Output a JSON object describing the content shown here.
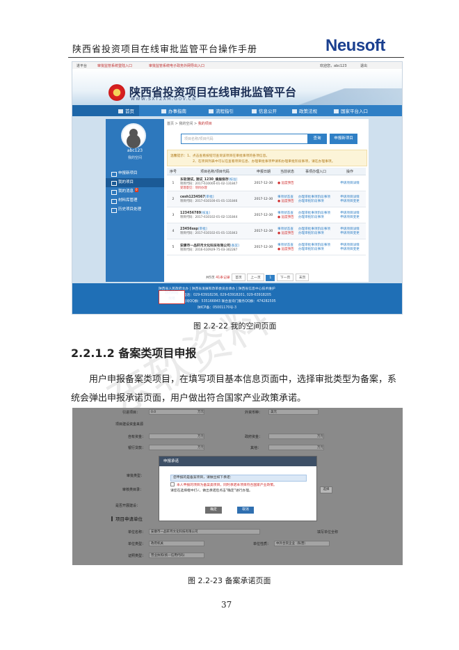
{
  "header": {
    "doc_title": "陕西省投资项目在线审批监管平台操作手册",
    "brand": "Neusoft"
  },
  "screenshot1": {
    "topbar": {
      "home": "进平台",
      "link1": "审批监管系统登陆入口",
      "link2": "审批监管系统电子政务外网导出入口",
      "welcome": "欢迎您，abc123",
      "logout": "退出"
    },
    "site_title": "陕西省投资项目在线审批监管平台",
    "site_url": "WWW.SXTZXM.GOV.CN",
    "nav": [
      "首页",
      "办事指南",
      "流程指引",
      "信息公开",
      "政策法规",
      "国家平台入口"
    ],
    "user": {
      "name": "abc123",
      "space": "我的空间"
    },
    "side_menu": [
      {
        "label": "申报新项目"
      },
      {
        "label": "我的项目"
      },
      {
        "label": "我的消息",
        "badge": "0"
      },
      {
        "label": "材料库管理"
      },
      {
        "label": "历史项目处理"
      }
    ],
    "breadcrumb": {
      "prefix": "首页 > 我的空间 > ",
      "current": "我的项目"
    },
    "search": {
      "placeholder": "项目名称/项目代码",
      "query_btn": "查询",
      "apply_btn": "申报新项目"
    },
    "notice": {
      "line1": "温馨提示：1、点击查看按钮可查询该项目在审批事项的各项信息。",
      "line2": "2、在项目列表中可以在查看项目信息、办理审批事项申请和办理审批阶段事项，请在办理事项。"
    },
    "table": {
      "headers": [
        "序号",
        "项目名称/项目代码",
        "申报日期",
        "当前状态",
        "事项办理入口",
        "操作"
      ],
      "rows": [
        {
          "no": "1",
          "name": "东软测试, 测试_1230_填报保存",
          "tag": "[核准]",
          "code": "项目代码：2017-610000-01-02-131847",
          "note": "受理意见：项目办理",
          "date": "2017-12-30",
          "status": "● 远度预告",
          "status2": "",
          "entry1": "",
          "entry2": "",
          "op1": "申请项目详情",
          "op2": ""
        },
        {
          "no": "2",
          "name": "cesh1234567",
          "tag": "[审批]",
          "code": "项目代码：2017-610100-01-01-131846",
          "note": "",
          "date": "2017-12-30",
          "status": "事项状态查",
          "status2": "● 远度预告",
          "entry1": "办理审批事项阶段事项",
          "entry2": "办理审批阶段事项",
          "op1": "申请项目详情",
          "op2": "申请项目变更"
        },
        {
          "no": "3",
          "name": "123456789",
          "tag": "[核准]",
          "code": "项目代码：2017-610102-01-02-131844",
          "note": "",
          "date": "2017-12-30",
          "status": "事项状态查",
          "status2": "● 远度预告",
          "entry1": "办理审批事项阶段事项",
          "entry2": "办理审批阶段事项",
          "op1": "申请项目详情",
          "op2": "申请项目变更"
        },
        {
          "no": "4",
          "name": "23456ssp",
          "tag": "[审批]",
          "code": "项目代码：2017-610102-01-01-131843",
          "note": "",
          "date": "2017-12-30",
          "status": "事项状态查",
          "status2": "● 远度预告",
          "entry1": "办理审批事项阶段事项",
          "entry2": "办理审批阶段事项",
          "op1": "申请项目详情",
          "op2": "申请项目变更"
        },
        {
          "no": "5",
          "name": "安康市一品轩月文化科技有限公司",
          "tag": "[备案]",
          "code": "项目代码：2016-610929-75-03-302287",
          "note": "",
          "date": "2017-12-30",
          "status": "事项状态查",
          "status2": "● 远度预告",
          "entry1": "办理审批事项阶段事项",
          "entry2": "办理审批阶段事项",
          "op1": "申请项目详情",
          "op2": "申请项目变更"
        }
      ]
    },
    "pager": {
      "prefix": "共5页",
      "total": "41条记录",
      "first": "首页",
      "prev": "上一页",
      "current": "1",
      "next": "下一页",
      "last": "末页"
    },
    "footer": {
      "line1": "陕西省人民政府主办 | 陕西省发展和改革委员会承办 | 陕西省信息中心技术维护",
      "line2": "咨询电话：029-63918236, 029-63918201, 029-63918205",
      "line3": "中国电子个人咨询QQ群：535166843    联合查询门服务QQ群：474282505",
      "line4": "陕ICP备：05001170号-3",
      "badge_line1": "政府网站",
      "badge_line2": "找错"
    }
  },
  "caption1": "图  2.2-22    我的空间页面",
  "section_heading": "2.2.1.2 备案类项目申报",
  "para_line1": "用户申报备案类项目，在填写项目基本信息页面中，选择审批类型为备案，系",
  "para_line2": "统会弹出申报承诺页面，用户做出符合国家产业政策承诺。",
  "screenshot2": {
    "fields": {
      "invest_label": "引进项目：",
      "invest_value": "0.0",
      "invest_unit": "万元",
      "currency_label": "外资币种：",
      "currency_value": "美元",
      "section_fund": "项目建设资金来源",
      "own_label": "自有资金：",
      "own_unit": "万元",
      "gov_label": "政府资金：",
      "gov_unit": "万元",
      "bank_label": "银行贷款：",
      "bank_unit": "万元",
      "other_label": "其他：",
      "other_unit": "万元",
      "approval_label": "审批类型：",
      "catalog_label": "审核类目录：",
      "industry_label": "所属行业：",
      "select_btn": "选择",
      "build_label": "是否开展建设：",
      "section_applicant": "项目申请单位",
      "unit_name_label": "单位名称：",
      "unit_name_value": "安康市一品轩月文化科技有限公司",
      "fill_note": "填写单位全称",
      "unit_type_label": "单位类型：",
      "unit_type_value": "政府机关",
      "unit_nature_label": "单位性质：",
      "unit_nature_value": "中外合资企业（私营）",
      "cert_label": "证照类型：",
      "cert_value": "营业执照(统一信用代码)"
    },
    "modal": {
      "title": "申报承诺",
      "row1": "您申报的是备案项目，请做出如下承诺：",
      "row2": "本人申报的项目为备案类项目，同时承诺本项目符合国家产业政策。",
      "row3": "请您在选择框中打√，做出承诺后点击\"确定\"进行办理。",
      "ok": "确定",
      "cancel": "取消"
    }
  },
  "caption2": "图  2.2-23    备案承诺页面",
  "page_number": "37"
}
